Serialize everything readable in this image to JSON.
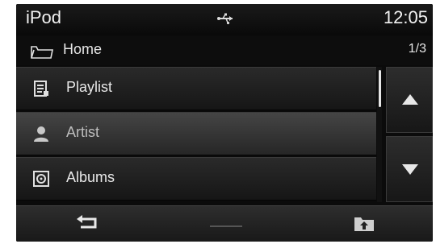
{
  "status": {
    "app_title": "iPod",
    "usb_icon": "usb-icon",
    "clock": "12:05"
  },
  "breadcrumb": {
    "icon": "folder-icon",
    "label": "Home",
    "page": "1/3"
  },
  "list": {
    "items": [
      {
        "label": "Playlist",
        "icon": "playlist-icon",
        "selected": false
      },
      {
        "label": "Artist",
        "icon": "artist-icon",
        "selected": true
      },
      {
        "label": "Albums",
        "icon": "album-icon",
        "selected": false
      }
    ]
  },
  "controls": {
    "up_icon": "arrow-up-icon",
    "down_icon": "arrow-down-icon"
  },
  "bottom": {
    "back_icon": "back-icon",
    "up_folder_icon": "folder-up-icon"
  }
}
